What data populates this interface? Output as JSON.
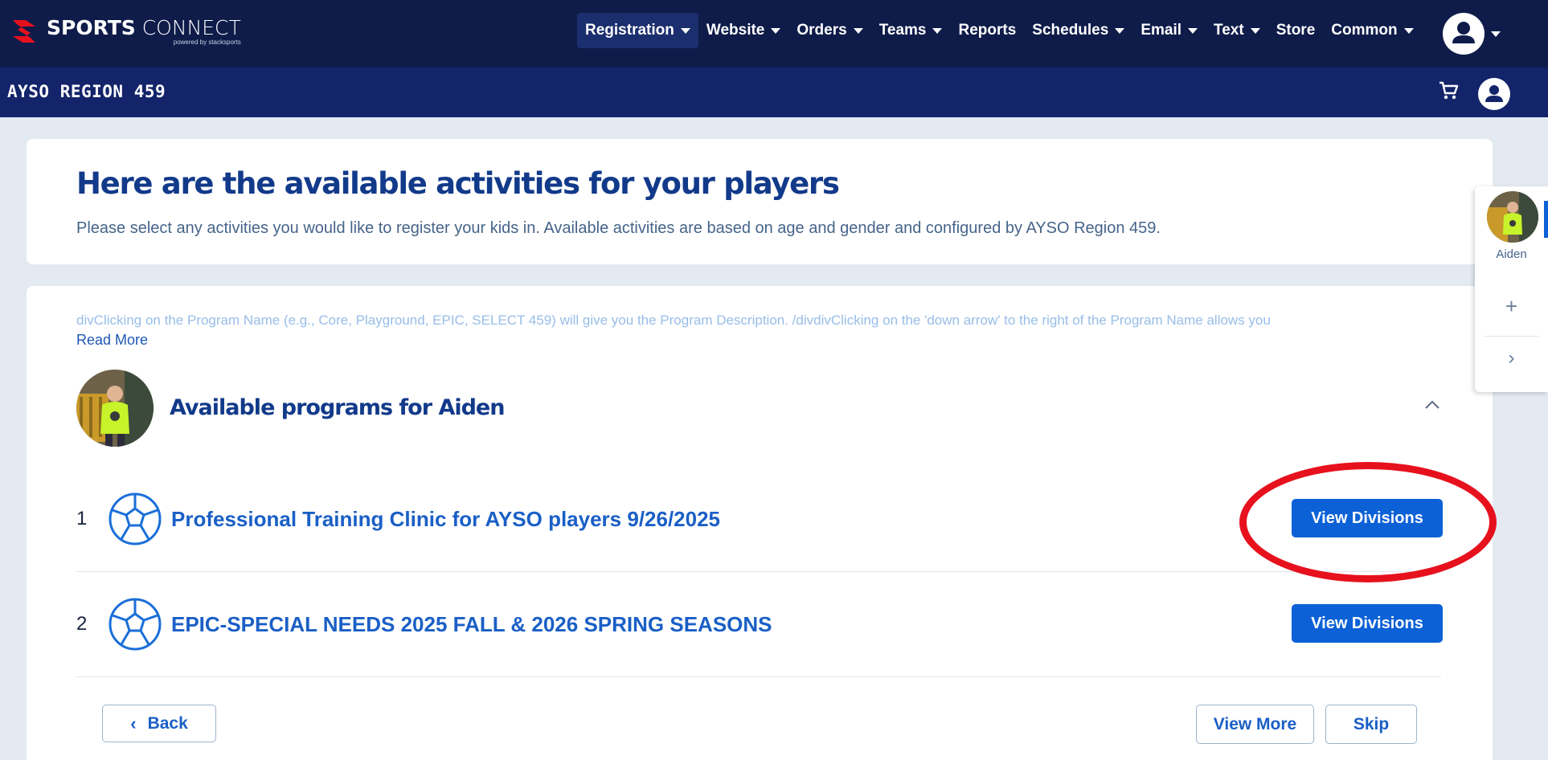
{
  "brand": {
    "name_bold": "SPORTS",
    "name_light": " CONNECT",
    "tagline": "powered by stacksports",
    "accent_color": "#e6111d"
  },
  "nav": {
    "items": [
      {
        "label": "Registration",
        "dropdown": true,
        "active": true
      },
      {
        "label": "Website",
        "dropdown": true
      },
      {
        "label": "Orders",
        "dropdown": true
      },
      {
        "label": "Teams",
        "dropdown": true
      },
      {
        "label": "Reports",
        "dropdown": false
      },
      {
        "label": "Schedules",
        "dropdown": true
      },
      {
        "label": "Email",
        "dropdown": true
      },
      {
        "label": "Text",
        "dropdown": true
      },
      {
        "label": "Store",
        "dropdown": false
      },
      {
        "label": "Common",
        "dropdown": true
      }
    ]
  },
  "subbar": {
    "org_name": "AYSO REGION 459"
  },
  "header": {
    "title": "Here are the available activities for your players",
    "description": "Please select any activities you would like to register your kids in. Available activities are based on age and gender and configured by AYSO Region 459."
  },
  "notice": {
    "text": "divClicking on the Program Name (e.g., Core, Playground, EPIC, SELECT 459) will give you the Program Description. /divdivClicking on the 'down arrow' to the right of the Program Name allows you",
    "read_more": "Read More"
  },
  "player": {
    "section_title": "Available programs for Aiden",
    "name": "Aiden"
  },
  "programs": [
    {
      "number": "1",
      "name": "Professional Training Clinic for AYSO players 9/26/2025",
      "button": "View Divisions"
    },
    {
      "number": "2",
      "name": "EPIC-SPECIAL NEEDS 2025 FALL & 2026 SPRING SEASONS",
      "button": "View Divisions"
    }
  ],
  "footer": {
    "back": "Back",
    "view_more": "View More",
    "skip": "Skip"
  },
  "side_panel": {
    "plus": "+",
    "next": "›"
  }
}
